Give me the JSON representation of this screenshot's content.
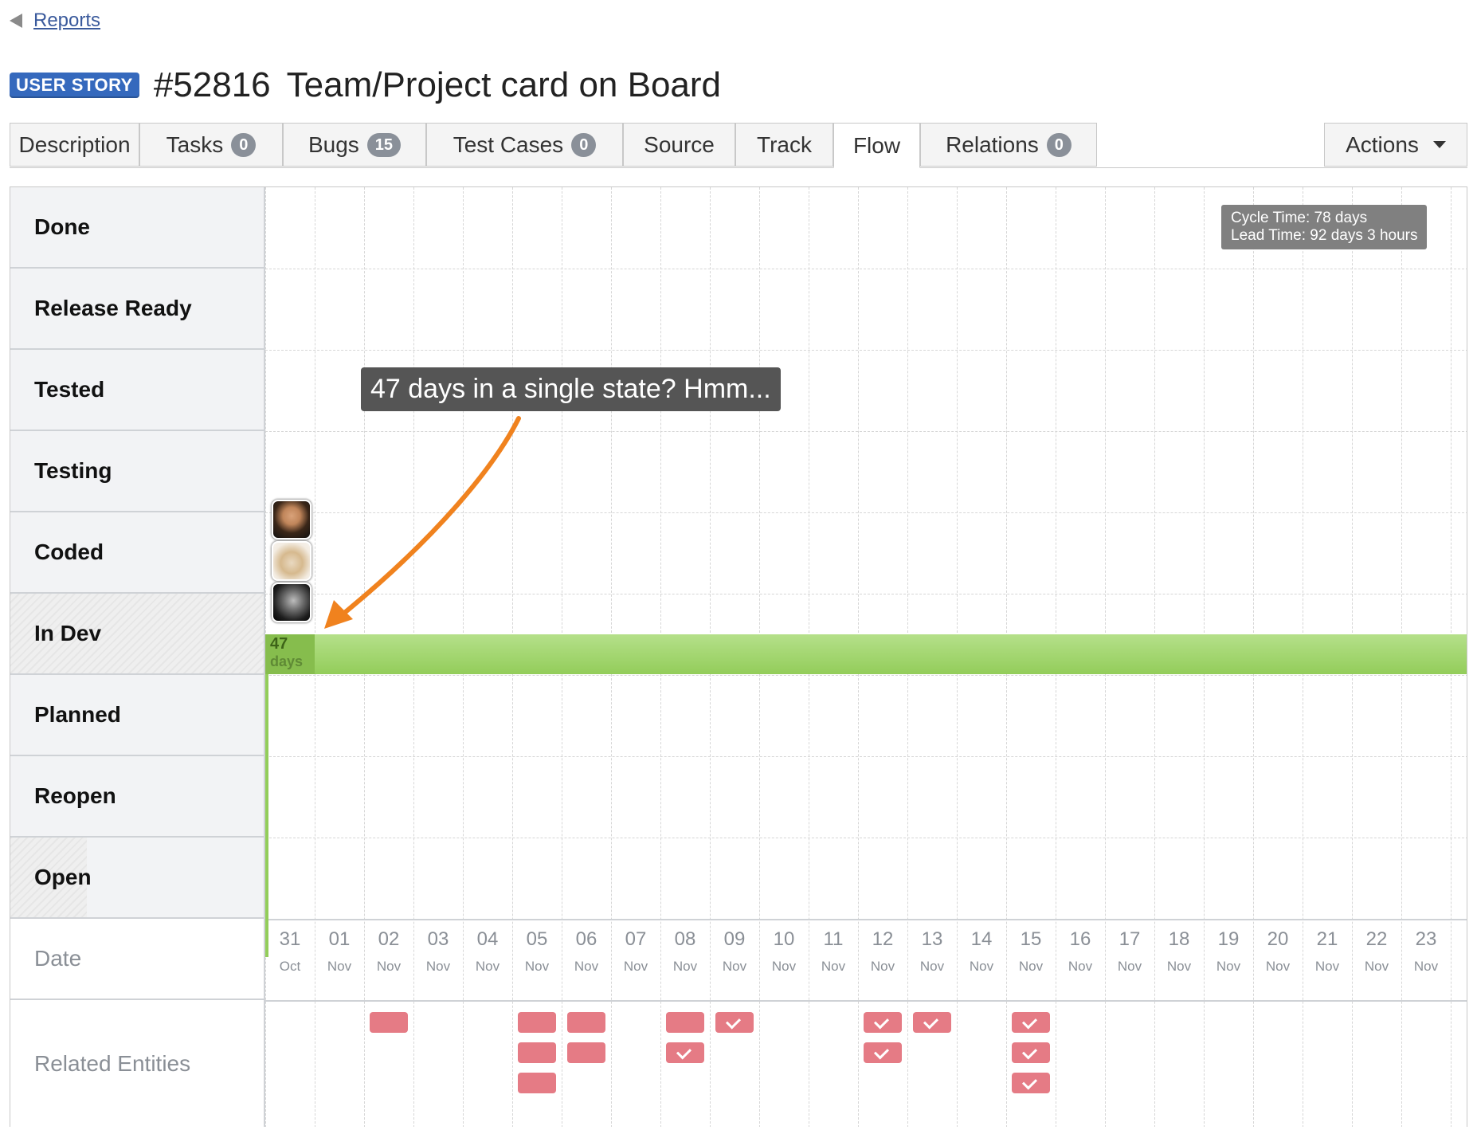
{
  "nav": {
    "back_label": "Reports"
  },
  "entity": {
    "type_badge": "USER STORY",
    "id": "#52816",
    "title": "Team/Project card on Board"
  },
  "tabs": [
    {
      "label": "Description"
    },
    {
      "label": "Tasks",
      "count": "0"
    },
    {
      "label": "Bugs",
      "count": "15"
    },
    {
      "label": "Test Cases",
      "count": "0"
    },
    {
      "label": "Source"
    },
    {
      "label": "Track"
    },
    {
      "label": "Flow",
      "active": true
    },
    {
      "label": "Relations",
      "count": "0"
    }
  ],
  "actions_label": "Actions",
  "flow": {
    "states": [
      "Done",
      "Release Ready",
      "Tested",
      "Testing",
      "Coded",
      "In Dev",
      "Planned",
      "Reopen",
      "Open"
    ],
    "date_label": "Date",
    "related_label": "Related Entities",
    "cycle_time": "Cycle Time:  78 days",
    "lead_time": "Lead Time:  92 days 3 hours",
    "callout": "47 days in a single state? Hmm...",
    "bar": {
      "days": "47",
      "unit": "days"
    },
    "dates": [
      {
        "day": "31",
        "month": "Oct"
      },
      {
        "day": "01",
        "month": "Nov"
      },
      {
        "day": "02",
        "month": "Nov"
      },
      {
        "day": "03",
        "month": "Nov"
      },
      {
        "day": "04",
        "month": "Nov"
      },
      {
        "day": "05",
        "month": "Nov"
      },
      {
        "day": "06",
        "month": "Nov"
      },
      {
        "day": "07",
        "month": "Nov"
      },
      {
        "day": "08",
        "month": "Nov"
      },
      {
        "day": "09",
        "month": "Nov"
      },
      {
        "day": "10",
        "month": "Nov"
      },
      {
        "day": "11",
        "month": "Nov"
      },
      {
        "day": "12",
        "month": "Nov"
      },
      {
        "day": "13",
        "month": "Nov"
      },
      {
        "day": "14",
        "month": "Nov"
      },
      {
        "day": "15",
        "month": "Nov"
      },
      {
        "day": "16",
        "month": "Nov"
      },
      {
        "day": "17",
        "month": "Nov"
      },
      {
        "day": "18",
        "month": "Nov"
      },
      {
        "day": "19",
        "month": "Nov"
      },
      {
        "day": "20",
        "month": "Nov"
      },
      {
        "day": "21",
        "month": "Nov"
      },
      {
        "day": "22",
        "month": "Nov"
      },
      {
        "day": "23",
        "month": "Nov"
      }
    ],
    "related": [
      {
        "date": "02",
        "items": [
          "open"
        ]
      },
      {
        "date": "05",
        "items": [
          "open",
          "open",
          "open"
        ]
      },
      {
        "date": "06",
        "items": [
          "open",
          "open"
        ]
      },
      {
        "date": "08",
        "items": [
          "open",
          "done"
        ]
      },
      {
        "date": "09",
        "items": [
          "done"
        ]
      },
      {
        "date": "12",
        "items": [
          "done",
          "done"
        ]
      },
      {
        "date": "13",
        "items": [
          "done"
        ]
      },
      {
        "date": "15",
        "items": [
          "done",
          "done",
          "done"
        ]
      }
    ],
    "colors": {
      "bar": "#93cd5a",
      "related": "#e57b85",
      "badge": "#3569bd"
    }
  }
}
